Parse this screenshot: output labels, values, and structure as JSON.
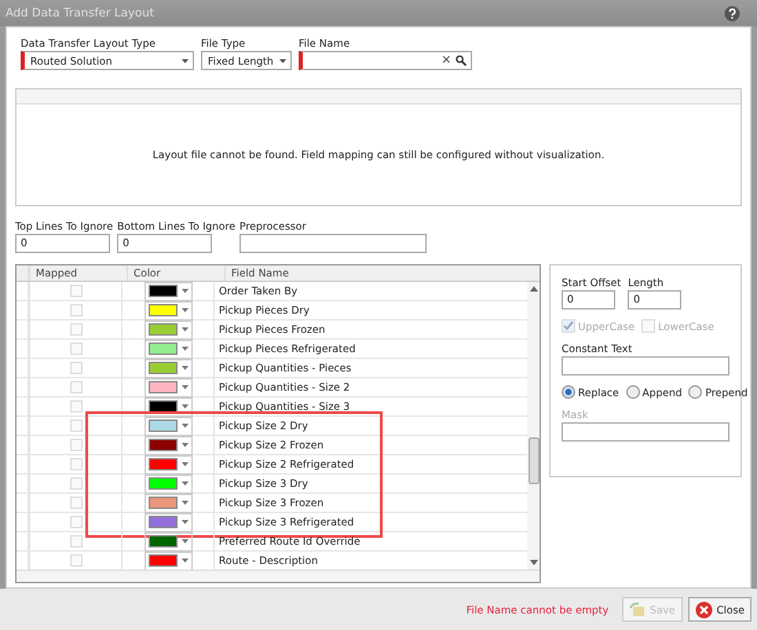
{
  "window": {
    "title": "Add Data Transfer Layout"
  },
  "top_fields": [
    {
      "label": "Data Transfer Layout Type",
      "kind": "dropdown",
      "value": "Routed Solution",
      "required": true
    },
    {
      "label": "File Type",
      "kind": "dropdown",
      "value": "Fixed Length",
      "required": false
    },
    {
      "label": "File Name",
      "kind": "search",
      "required": true,
      "clear": "×"
    }
  ],
  "visualization": {
    "message": "Layout file cannot be found. Field mapping can still be configured without visualization."
  },
  "ignore_fields": [
    {
      "label": "Top Lines To Ignore",
      "value": "0"
    },
    {
      "label": "Bottom Lines To Ignore",
      "value": "0"
    },
    {
      "label": "Preprocessor"
    }
  ],
  "table": {
    "columns": [
      "Mapped",
      "Color",
      "Field Name"
    ],
    "rows": [
      {
        "mapped": false,
        "color": "#000000",
        "field": "Order Taken By",
        "highlighted": false
      },
      {
        "mapped": false,
        "color": "#ffff00",
        "field": "Pickup Pieces Dry",
        "highlighted": false
      },
      {
        "mapped": false,
        "color": "#9acd32",
        "field": "Pickup Pieces Frozen",
        "highlighted": false
      },
      {
        "mapped": false,
        "color": "#90ee90",
        "field": "Pickup Pieces Refrigerated",
        "highlighted": false
      },
      {
        "mapped": false,
        "color": "#9acd32",
        "field": "Pickup Quantities - Pieces",
        "highlighted": false
      },
      {
        "mapped": false,
        "color": "#ffb6c1",
        "field": "Pickup Quantities - Size 2",
        "highlighted": false
      },
      {
        "mapped": false,
        "color": "#000000",
        "field": "Pickup Quantities - Size 3",
        "highlighted": false
      },
      {
        "mapped": false,
        "color": "#add8e6",
        "field": "Pickup Size 2 Dry",
        "highlighted": true
      },
      {
        "mapped": false,
        "color": "#8b0000",
        "field": "Pickup Size 2 Frozen",
        "highlighted": true
      },
      {
        "mapped": false,
        "color": "#ff0000",
        "field": "Pickup Size 2 Refrigerated",
        "highlighted": true
      },
      {
        "mapped": false,
        "color": "#00ff00",
        "field": "Pickup Size 3 Dry",
        "highlighted": true
      },
      {
        "mapped": false,
        "color": "#e9967a",
        "field": "Pickup Size 3 Frozen",
        "highlighted": true
      },
      {
        "mapped": false,
        "color": "#9370db",
        "field": "Pickup Size 3 Refrigerated",
        "highlighted": true
      },
      {
        "mapped": false,
        "color": "#006400",
        "field": "Preferred Route Id Override",
        "highlighted": false
      },
      {
        "mapped": false,
        "color": "#ff0000",
        "field": "Route - Description",
        "highlighted": false
      }
    ]
  },
  "properties": {
    "start_offset": {
      "label": "Start Offset",
      "value": "0"
    },
    "length": {
      "label": "Length",
      "value": "0"
    },
    "case_options": [
      {
        "label": "UpperCase",
        "checked": true,
        "disabled": true
      },
      {
        "label": "LowerCase",
        "checked": false,
        "disabled": true
      }
    ],
    "constant_text": {
      "label": "Constant Text"
    },
    "modes": [
      {
        "label": "Replace",
        "selected": true
      },
      {
        "label": "Append",
        "selected": false
      },
      {
        "label": "Prepend",
        "selected": false
      }
    ],
    "mask": {
      "label": "Mask",
      "disabled": true
    }
  },
  "footer": {
    "error": "File Name cannot be empty",
    "buttons": [
      {
        "label": "Save",
        "disabled": true,
        "kind": "save"
      },
      {
        "label": "Close",
        "disabled": false,
        "kind": "close"
      }
    ]
  }
}
